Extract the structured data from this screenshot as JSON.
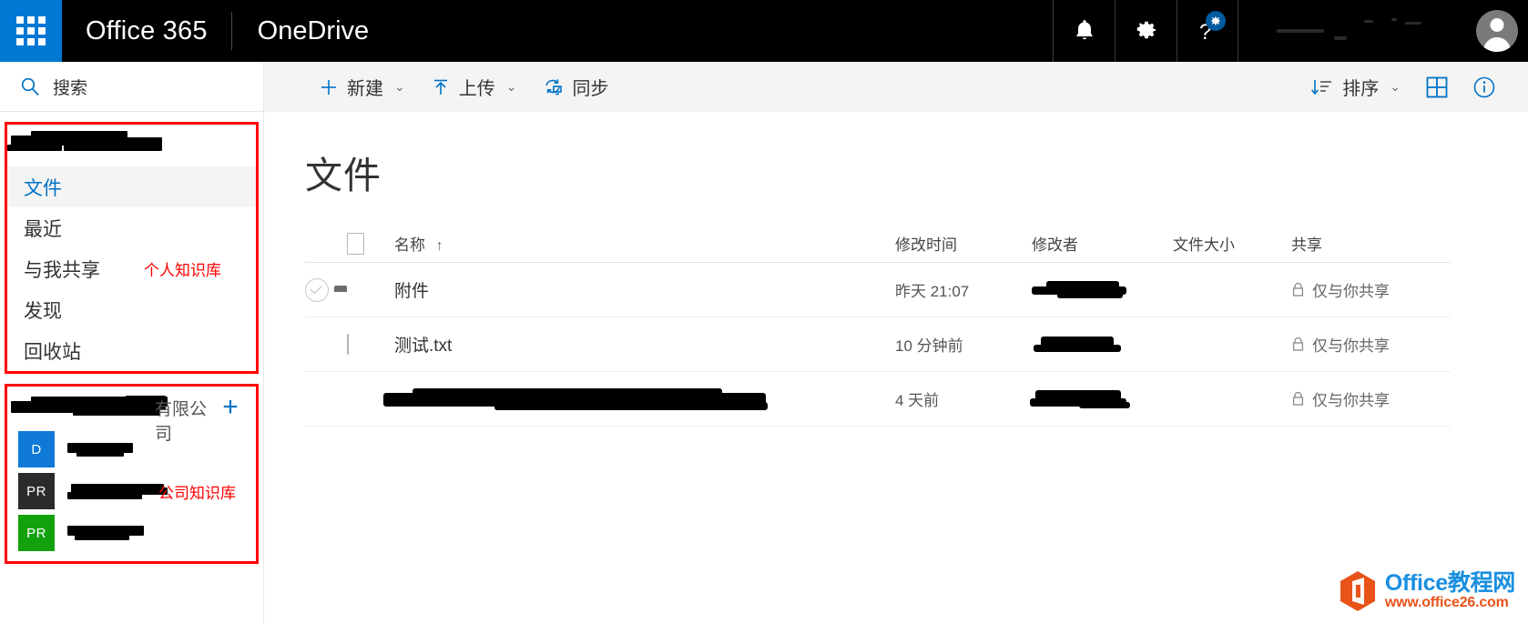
{
  "suite": {
    "waffle_icon": "waffle-grid-icon",
    "brand": "Office 365",
    "app_name": "OneDrive",
    "icons": [
      {
        "name": "notifications-bell-icon",
        "glyph": "bell"
      },
      {
        "name": "settings-gear-icon",
        "glyph": "gear"
      },
      {
        "name": "help-question-icon",
        "glyph": "question"
      }
    ],
    "avatar_name": "user-avatar"
  },
  "search": {
    "icon": "search-icon",
    "placeholder": "搜索",
    "value": ""
  },
  "sidebar": {
    "personal_annotation": "个人知识库",
    "org_annotation": "公司知识库",
    "my_files_heading_redacted": true,
    "items": [
      {
        "label": "文件",
        "selected": true
      },
      {
        "label": "最近",
        "selected": false
      },
      {
        "label": "与我共享",
        "selected": false
      },
      {
        "label": "发现",
        "selected": false
      },
      {
        "label": "回收站",
        "selected": false
      }
    ],
    "org": {
      "name_suffix": "有限公司",
      "add_button": "+",
      "sites": [
        {
          "tile_text": "D",
          "tile_color": "#0f79d8",
          "name_redacted": true
        },
        {
          "tile_text": "PR",
          "tile_color": "#2b2b2b",
          "name_redacted": true
        },
        {
          "tile_text": "PR",
          "tile_color": "#13a10e",
          "name_redacted": true
        }
      ]
    }
  },
  "commandbar": {
    "new_label": "新建",
    "upload_label": "上传",
    "sync_label": "同步",
    "sort_label": "排序",
    "view_icon": "grid-view-icon",
    "info_icon": "info-icon"
  },
  "main": {
    "title": "文件",
    "columns": {
      "name": "名称",
      "sort_arrow": "↑",
      "modified": "修改时间",
      "modified_by": "修改者",
      "size": "文件大小",
      "sharing": "共享"
    },
    "rows": [
      {
        "icon": "folder-icon",
        "name": "附件",
        "name_redacted": false,
        "modified": "昨天 21:07",
        "modified_by_redacted": true,
        "size": "",
        "sharing": "仅与你共享",
        "selected_circle": true
      },
      {
        "icon": "text-document-icon",
        "name": "测试.txt",
        "name_redacted": false,
        "modified": "10 分钟前",
        "modified_by_redacted": true,
        "size": "",
        "sharing": "仅与你共享",
        "selected_circle": false
      },
      {
        "icon": "presentation-icon",
        "name": "",
        "name_redacted": true,
        "modified": "4 天前",
        "modified_by_redacted": true,
        "size": "",
        "sharing": "仅与你共享",
        "selected_circle": false
      }
    ]
  },
  "watermark": {
    "site_name": "Office教程网",
    "site_url": "www.office26.com"
  },
  "colors": {
    "suite_bar": "#000000",
    "waffle_blue": "#0078d4",
    "accent": "#0072c6",
    "command_bar": "#f4f4f4",
    "annotation_red": "#ff0000",
    "watermark_blue": "#1a8fe0",
    "watermark_orange": "#e8531a"
  }
}
